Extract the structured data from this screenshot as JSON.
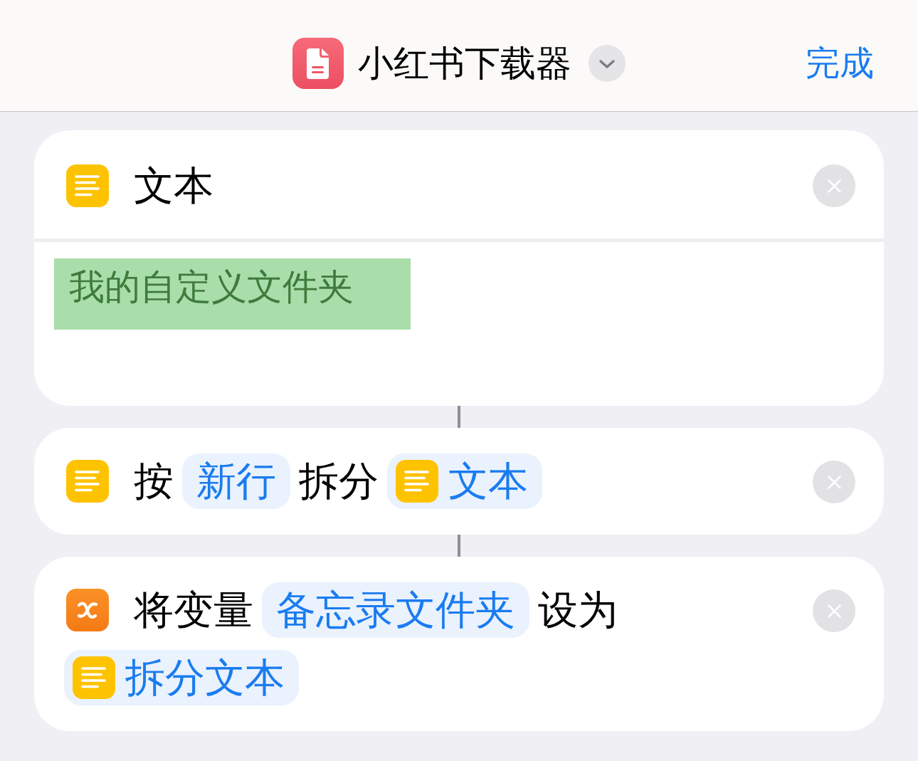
{
  "nav_bar": {
    "title": "小红书下载器",
    "done": "完成"
  },
  "actions": [
    {
      "kind": "text",
      "title": "文本",
      "content": {
        "text": "我的自定义文件夹",
        "highlighted": true
      }
    },
    {
      "kind": "split_text",
      "parts": [
        {
          "kind": "label",
          "text": "按"
        },
        {
          "kind": "parameter",
          "text": "新行"
        },
        {
          "kind": "label",
          "text": "拆分"
        },
        {
          "kind": "variable",
          "text": "文本"
        }
      ]
    },
    {
      "kind": "set_variable",
      "parts": [
        {
          "kind": "label",
          "text": "将变量"
        },
        {
          "kind": "parameter",
          "text": "备忘录文件夹"
        },
        {
          "kind": "label",
          "text": "设为"
        },
        {
          "kind": "variable",
          "text": "拆分文本"
        }
      ]
    }
  ]
}
